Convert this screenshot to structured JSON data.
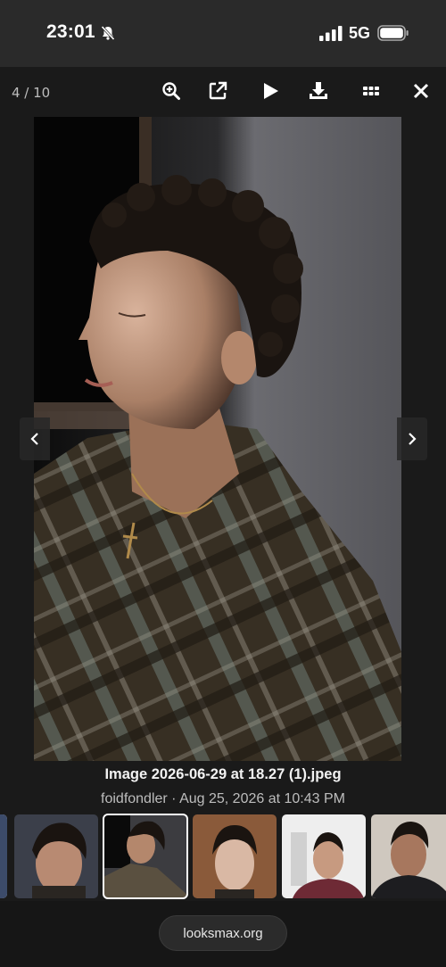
{
  "status_bar": {
    "time": "23:01",
    "network": "5G",
    "icons": [
      "bell-slash-icon",
      "signal-icon",
      "battery-icon"
    ]
  },
  "viewer": {
    "counter": "4 / 10",
    "toolbar": {
      "tools": [
        "zoom-in-icon",
        "open-external-icon",
        "play-icon",
        "download-icon",
        "grid-icon",
        "close-icon"
      ]
    },
    "image": {
      "description": "Photo of a curly-haired young man in a plaid shirt, side profile lit by warm light",
      "icon": "photo"
    },
    "caption": {
      "title": "Image 2026-06-29 at 18.27 (1).jpeg",
      "meta": "foidfondler · Aug 25, 2026 at 10:43 PM"
    },
    "nav": [
      "chevron-left-icon",
      "chevron-right-icon"
    ],
    "thumbnails_count": 6,
    "active_thumbnail": 2
  },
  "browser": {
    "url": "looksmax.org"
  },
  "colors": {
    "background": "#1a1a1a",
    "status_bar": "#2a2a2a",
    "accent_white": "#ffffff"
  }
}
